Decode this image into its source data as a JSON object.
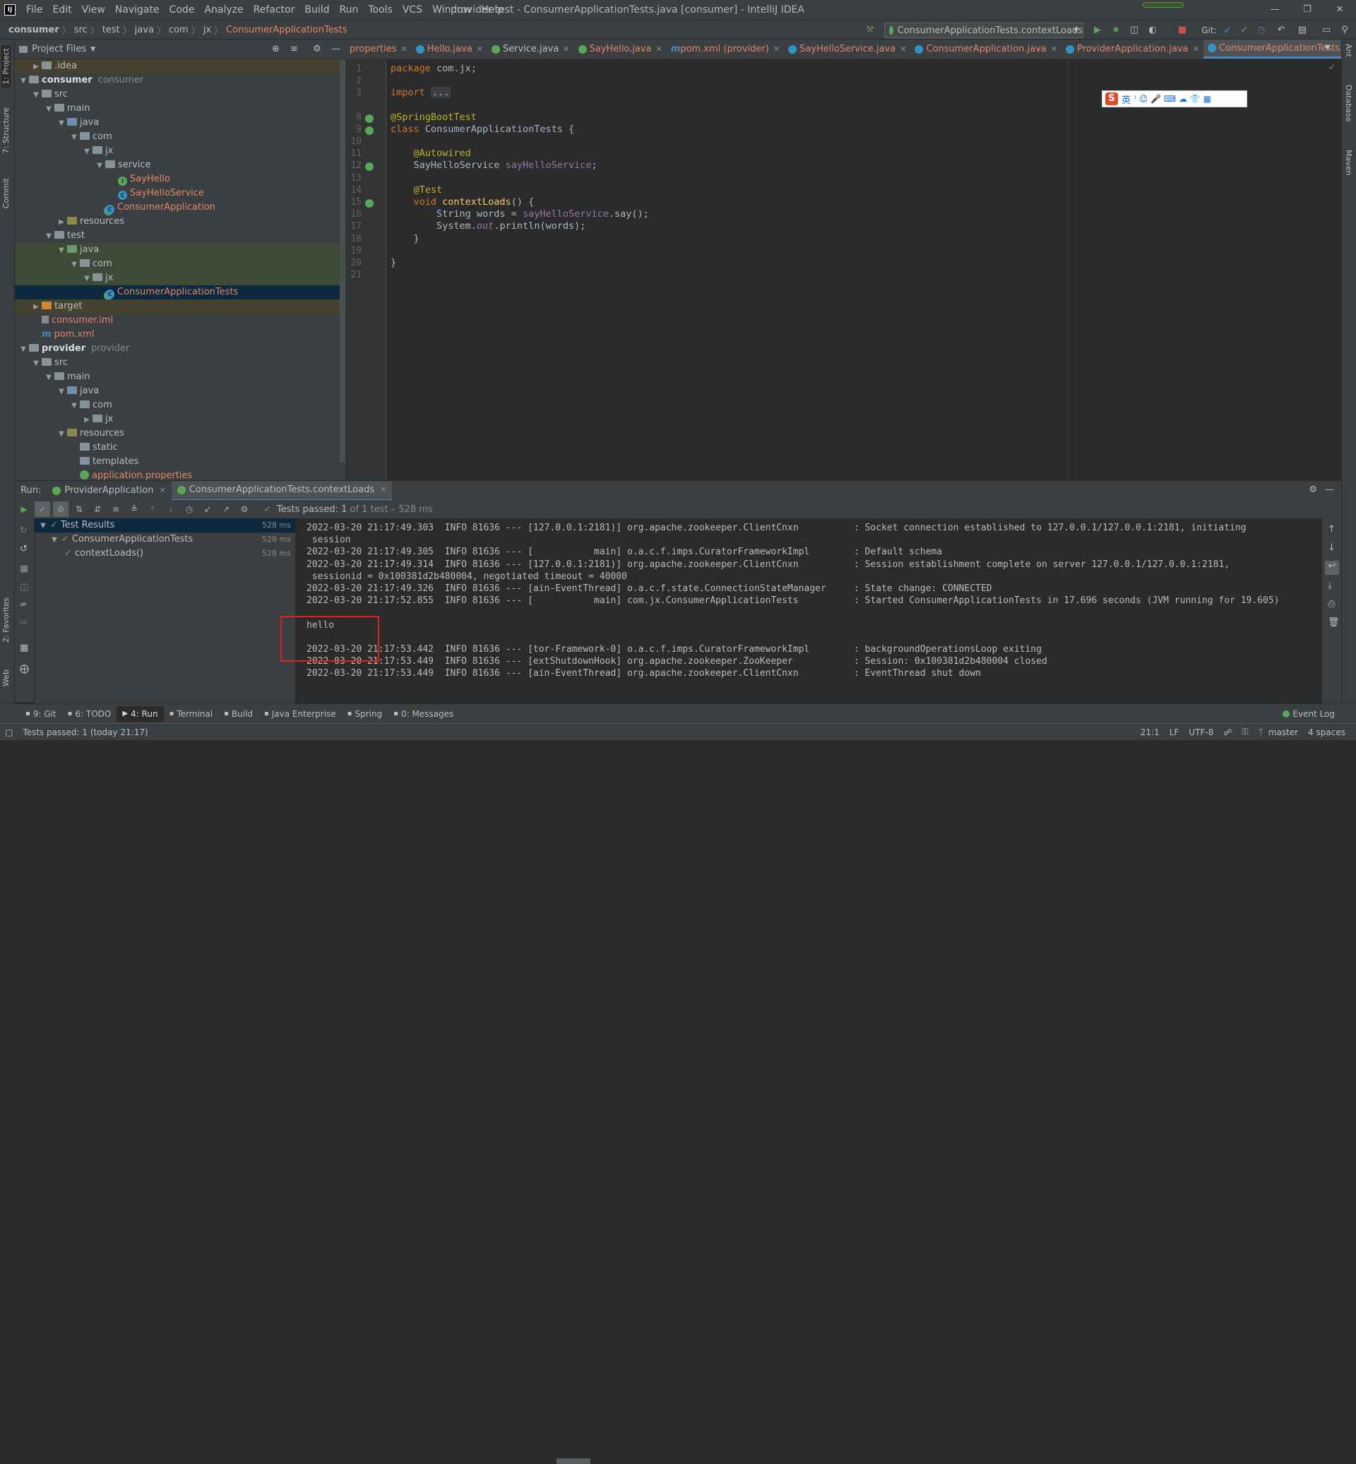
{
  "app": {
    "title": "provider-test - ConsumerApplicationTests.java [consumer] - IntelliJ IDEA",
    "logo": "IJ"
  },
  "menu": [
    "File",
    "Edit",
    "View",
    "Navigate",
    "Code",
    "Analyze",
    "Refactor",
    "Build",
    "Run",
    "Tools",
    "VCS",
    "Window",
    "Help"
  ],
  "breadcrumbs": [
    "consumer",
    "src",
    "test",
    "java",
    "com",
    "jx",
    "ConsumerApplicationTests"
  ],
  "toolbar": {
    "run_config": "ConsumerApplicationTests.contextLoads",
    "git_label": "Git:"
  },
  "left_strip": [
    "1: Project",
    "7: Structure",
    "Commit",
    "2: Favorites",
    "Web"
  ],
  "right_strip": [
    "Ant",
    "Database",
    "Maven"
  ],
  "project": {
    "header": "Project Files",
    "tree": [
      {
        "indent": 1,
        "arrow": "▶",
        "icon": "folder",
        "label": ".idea",
        "extra": "",
        "color": "",
        "bg": "yellowish"
      },
      {
        "indent": 0,
        "arrow": "▼",
        "icon": "folder",
        "label": "consumer",
        "extra": "consumer",
        "color": "bold",
        "bg": ""
      },
      {
        "indent": 1,
        "arrow": "▼",
        "icon": "folder",
        "label": "src",
        "extra": "",
        "color": "",
        "bg": ""
      },
      {
        "indent": 2,
        "arrow": "▼",
        "icon": "folder",
        "label": "main",
        "extra": "",
        "color": "",
        "bg": ""
      },
      {
        "indent": 3,
        "arrow": "▼",
        "icon": "folder-blue",
        "label": "java",
        "extra": "",
        "color": "",
        "bg": ""
      },
      {
        "indent": 4,
        "arrow": "▼",
        "icon": "folder",
        "label": "com",
        "extra": "",
        "color": "",
        "bg": ""
      },
      {
        "indent": 5,
        "arrow": "▼",
        "icon": "folder",
        "label": "jx",
        "extra": "",
        "color": "",
        "bg": ""
      },
      {
        "indent": 6,
        "arrow": "▼",
        "icon": "folder",
        "label": "service",
        "extra": "",
        "color": "",
        "bg": ""
      },
      {
        "indent": 7,
        "arrow": "",
        "icon": "interface",
        "label": "SayHello",
        "extra": "",
        "color": "red",
        "bg": ""
      },
      {
        "indent": 7,
        "arrow": "",
        "icon": "class",
        "label": "SayHelloService",
        "extra": "",
        "color": "red",
        "bg": ""
      },
      {
        "indent": 6,
        "arrow": "",
        "icon": "spring-class",
        "label": "ConsumerApplication",
        "extra": "",
        "color": "red",
        "bg": ""
      },
      {
        "indent": 3,
        "arrow": "▶",
        "icon": "folder-res",
        "label": "resources",
        "extra": "",
        "color": "",
        "bg": ""
      },
      {
        "indent": 2,
        "arrow": "▼",
        "icon": "folder",
        "label": "test",
        "extra": "",
        "color": "",
        "bg": ""
      },
      {
        "indent": 3,
        "arrow": "▼",
        "icon": "folder-green",
        "label": "java",
        "extra": "",
        "color": "",
        "bg": "sel-green"
      },
      {
        "indent": 4,
        "arrow": "▼",
        "icon": "folder",
        "label": "com",
        "extra": "",
        "color": "",
        "bg": "sel-green"
      },
      {
        "indent": 5,
        "arrow": "▼",
        "icon": "folder",
        "label": "jx",
        "extra": "",
        "color": "",
        "bg": "sel-green"
      },
      {
        "indent": 6,
        "arrow": "",
        "icon": "spring-class",
        "label": "ConsumerApplicationTests",
        "extra": "",
        "color": "red",
        "bg": "selected"
      },
      {
        "indent": 1,
        "arrow": "▶",
        "icon": "folder-orange",
        "label": "target",
        "extra": "",
        "color": "",
        "bg": "yellowish"
      },
      {
        "indent": 1,
        "arrow": "",
        "icon": "iml",
        "label": "consumer.iml",
        "extra": "",
        "color": "red",
        "bg": ""
      },
      {
        "indent": 1,
        "arrow": "",
        "icon": "maven",
        "label": "pom.xml",
        "extra": "",
        "color": "red",
        "bg": ""
      },
      {
        "indent": 0,
        "arrow": "▼",
        "icon": "folder",
        "label": "provider",
        "extra": "provider",
        "color": "bold",
        "bg": ""
      },
      {
        "indent": 1,
        "arrow": "▼",
        "icon": "folder",
        "label": "src",
        "extra": "",
        "color": "",
        "bg": ""
      },
      {
        "indent": 2,
        "arrow": "▼",
        "icon": "folder",
        "label": "main",
        "extra": "",
        "color": "",
        "bg": ""
      },
      {
        "indent": 3,
        "arrow": "▼",
        "icon": "folder-blue",
        "label": "java",
        "extra": "",
        "color": "",
        "bg": ""
      },
      {
        "indent": 4,
        "arrow": "▼",
        "icon": "folder",
        "label": "com",
        "extra": "",
        "color": "",
        "bg": ""
      },
      {
        "indent": 5,
        "arrow": "▶",
        "icon": "folder",
        "label": "jx",
        "extra": "",
        "color": "",
        "bg": ""
      },
      {
        "indent": 3,
        "arrow": "▼",
        "icon": "folder-res",
        "label": "resources",
        "extra": "",
        "color": "",
        "bg": ""
      },
      {
        "indent": 4,
        "arrow": "",
        "icon": "folder",
        "label": "static",
        "extra": "",
        "color": "",
        "bg": ""
      },
      {
        "indent": 4,
        "arrow": "",
        "icon": "folder",
        "label": "templates",
        "extra": "",
        "color": "",
        "bg": ""
      },
      {
        "indent": 4,
        "arrow": "",
        "icon": "properties",
        "label": "application.properties",
        "extra": "",
        "color": "red",
        "bg": ""
      }
    ]
  },
  "editor_tabs": [
    {
      "label": "properties",
      "color": "#e0866b",
      "icon": "",
      "active": false
    },
    {
      "label": "Hello.java",
      "color": "#e0866b",
      "icon": "#3592c4",
      "active": false
    },
    {
      "label": "Service.java",
      "color": "#bbbbbb",
      "icon": "#5aa65a",
      "active": false
    },
    {
      "label": "SayHello.java",
      "color": "#e0866b",
      "icon": "#5aa65a",
      "active": false
    },
    {
      "label": "pom.xml (provider)",
      "color": "#e0866b",
      "icon": "",
      "active": false
    },
    {
      "label": "SayHelloService.java",
      "color": "#e0866b",
      "icon": "#3592c4",
      "active": false
    },
    {
      "label": "ConsumerApplication.java",
      "color": "#e0866b",
      "icon": "#3592c4",
      "active": false
    },
    {
      "label": "ProviderApplication.java",
      "color": "#e0866b",
      "icon": "#3592c4",
      "active": false
    },
    {
      "label": "ConsumerApplicationTests.java",
      "color": "#e0866b",
      "icon": "#3592c4",
      "active": true
    }
  ],
  "code": {
    "line_numbers": [
      "1",
      "2",
      "3",
      "8",
      "9",
      "10",
      "11",
      "12",
      "13",
      "14",
      "15",
      "16",
      "17",
      "18",
      "19",
      "20",
      "21"
    ],
    "lines": [
      [
        {
          "t": "package ",
          "c": "kw"
        },
        {
          "t": "com.jx;",
          "c": ""
        }
      ],
      [],
      [
        {
          "t": "import ",
          "c": "kw"
        },
        {
          "t": "...",
          "c": "fold"
        }
      ],
      [
        {
          "t": "@SpringBootTest",
          "c": "an"
        }
      ],
      [
        {
          "t": "class ",
          "c": "kw"
        },
        {
          "t": "ConsumerApplicationTests {",
          "c": ""
        }
      ],
      [],
      [
        {
          "t": "    @Autowired",
          "c": "an"
        }
      ],
      [
        {
          "t": "    SayHelloService ",
          "c": ""
        },
        {
          "t": "sayHelloService",
          "c": "fld"
        },
        {
          "t": ";",
          "c": ""
        }
      ],
      [],
      [
        {
          "t": "    @Test",
          "c": "an"
        }
      ],
      [
        {
          "t": "    ",
          "c": ""
        },
        {
          "t": "void ",
          "c": "kw"
        },
        {
          "t": "contextLoads",
          "c": "fn"
        },
        {
          "t": "() {",
          "c": ""
        }
      ],
      [
        {
          "t": "        String words = ",
          "c": ""
        },
        {
          "t": "sayHelloService",
          "c": "fld"
        },
        {
          "t": ".say();",
          "c": ""
        }
      ],
      [
        {
          "t": "        System.",
          "c": ""
        },
        {
          "t": "out",
          "c": "fld it"
        },
        {
          "t": ".println(words);",
          "c": ""
        }
      ],
      [
        {
          "t": "    }",
          "c": ""
        }
      ],
      [],
      [
        {
          "t": "}",
          "c": ""
        }
      ],
      []
    ]
  },
  "ime": {
    "logo": "S",
    "lang": "英",
    "icons": "⁾ ☺ 🎤 ⌨ ☁ 👕 ▦"
  },
  "run": {
    "label": "Run:",
    "tabs": [
      "ProviderApplication",
      "ConsumerApplicationTests.contextLoads"
    ],
    "status_prefix": "Tests passed:",
    "status_count": "1",
    "status_suffix": "of 1 test – 528 ms",
    "tests": [
      {
        "indent": 0,
        "label": "Test Results",
        "dur": "528 ms"
      },
      {
        "indent": 1,
        "label": "ConsumerApplicationTests",
        "dur": "528 ms"
      },
      {
        "indent": 2,
        "label": "contextLoads()",
        "dur": "528 ms"
      }
    ],
    "console": [
      "2022-03-20 21:17:49.303  INFO 81636 --- [127.0.0.1:2181)] org.apache.zookeeper.ClientCnxn          : Socket connection established to 127.0.0.1/127.0.0.1:2181, initiating",
      " session",
      "2022-03-20 21:17:49.305  INFO 81636 --- [           main] o.a.c.f.imps.CuratorFrameworkImpl        : Default schema",
      "2022-03-20 21:17:49.314  INFO 81636 --- [127.0.0.1:2181)] org.apache.zookeeper.ClientCnxn          : Session establishment complete on server 127.0.0.1/127.0.0.1:2181,",
      " sessionid = 0x100381d2b480004, negotiated timeout = 40000",
      "2022-03-20 21:17:49.326  INFO 81636 --- [ain-EventThread] o.a.c.f.state.ConnectionStateManager     : State change: CONNECTED",
      "2022-03-20 21:17:52.855  INFO 81636 --- [           main] com.jx.ConsumerApplicationTests          : Started ConsumerApplicationTests in 17.696 seconds (JVM running for 19.605)",
      "",
      "hello",
      "",
      "2022-03-20 21:17:53.442  INFO 81636 --- [tor-Framework-0] o.a.c.f.imps.CuratorFrameworkImpl        : backgroundOperationsLoop exiting",
      "2022-03-20 21:17:53.449  INFO 81636 --- [extShutdownHook] org.apache.zookeeper.ZooKeeper           : Session: 0x100381d2b480004 closed",
      "2022-03-20 21:17:53.449  INFO 81636 --- [ain-EventThread] org.apache.zookeeper.ClientCnxn          : EventThread shut down"
    ]
  },
  "bottom_tools": [
    {
      "label": "9: Git",
      "active": false
    },
    {
      "label": "6: TODO",
      "active": false
    },
    {
      "label": "4: Run",
      "active": true
    },
    {
      "label": "Terminal",
      "active": false
    },
    {
      "label": "Build",
      "active": false
    },
    {
      "label": "Java Enterprise",
      "active": false
    },
    {
      "label": "Spring",
      "active": false
    },
    {
      "label": "0: Messages",
      "active": false
    }
  ],
  "event_log": "Event Log",
  "status": {
    "message": "Tests passed: 1 (today 21:17)",
    "position": "21:1",
    "line_sep": "LF",
    "encoding": "UTF-8",
    "branch": "master",
    "indent": "4 spaces"
  },
  "colors": {
    "accent": "#4a88c7",
    "modified_file": "#e0866b",
    "success": "#5aa65a",
    "highlight_box": "#e12020"
  }
}
